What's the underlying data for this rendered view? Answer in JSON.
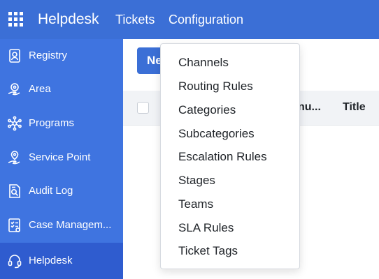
{
  "header": {
    "app_title": "Helpdesk",
    "nav": [
      {
        "label": "Tickets"
      },
      {
        "label": "Configuration"
      }
    ],
    "apps_icon": "grid-icon"
  },
  "sidebar": {
    "items": [
      {
        "label": "Registry",
        "icon": "id-badge-icon"
      },
      {
        "label": "Area",
        "icon": "map-pin-hand-icon"
      },
      {
        "label": "Programs",
        "icon": "network-icon"
      },
      {
        "label": "Service Point",
        "icon": "location-hand-icon"
      },
      {
        "label": "Audit Log",
        "icon": "document-search-icon"
      },
      {
        "label": "Case Managem...",
        "icon": "checklist-icon"
      },
      {
        "label": "Helpdesk",
        "icon": "headset-icon",
        "active": true
      }
    ]
  },
  "toolbar": {
    "new_button_label": "Ne"
  },
  "table": {
    "columns": [
      {
        "label": "nu..."
      },
      {
        "label": "Title"
      }
    ]
  },
  "configuration_menu": {
    "items": [
      {
        "label": "Channels"
      },
      {
        "label": "Routing Rules"
      },
      {
        "label": "Categories"
      },
      {
        "label": "Subcategories"
      },
      {
        "label": "Escalation Rules"
      },
      {
        "label": "Stages"
      },
      {
        "label": "Teams"
      },
      {
        "label": "SLA Rules"
      },
      {
        "label": "Ticket Tags"
      }
    ]
  },
  "colors": {
    "topbar": "#3b6fd6",
    "sidebar": "#3f74e0",
    "sidebar_active": "#2f5ccf",
    "primary_button": "#3b6fd6",
    "table_header": "#f1f3f6"
  }
}
